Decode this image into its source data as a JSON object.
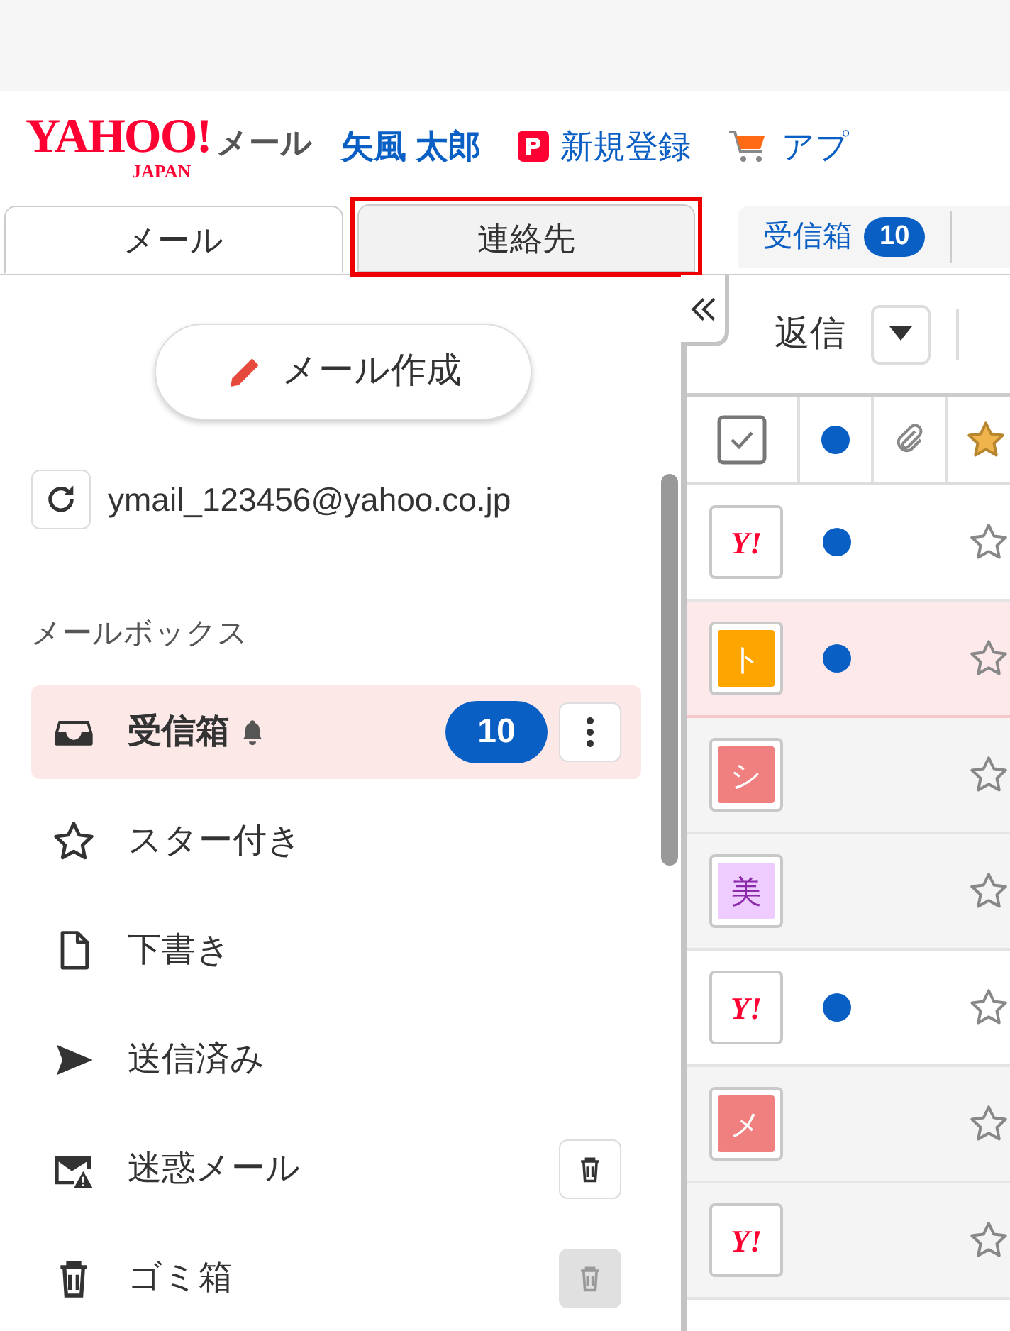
{
  "header": {
    "logo": {
      "main": "YAHOO!",
      "sub": "JAPAN"
    },
    "service": "メール",
    "user_name": "矢風 太郎",
    "links": [
      {
        "kind": "paypay",
        "label": "新規登録"
      },
      {
        "kind": "cart",
        "label": "アプ"
      }
    ]
  },
  "tabs": [
    {
      "label": "メール",
      "selected": true,
      "highlighted": false
    },
    {
      "label": "連絡先",
      "selected": false,
      "highlighted": true
    }
  ],
  "folder_chip": {
    "label": "受信箱",
    "count": "10"
  },
  "sidebar": {
    "compose": "メール作成",
    "account": "ymail_123456@yahoo.co.jp",
    "section": "メールボックス",
    "folders": [
      {
        "kind": "inbox",
        "label": "受信箱",
        "selected": true,
        "bell": true,
        "count": "10",
        "menu_button": true
      },
      {
        "kind": "star",
        "label": "スター付き",
        "selected": false,
        "bell": false
      },
      {
        "kind": "draft",
        "label": "下書き",
        "selected": false,
        "bell": false
      },
      {
        "kind": "sent",
        "label": "送信済み",
        "selected": false,
        "bell": false
      },
      {
        "kind": "spam",
        "label": "迷惑メール",
        "selected": false,
        "bell": false,
        "clear_button": true,
        "clear_disabled": false
      },
      {
        "kind": "trash",
        "label": "ゴミ箱",
        "selected": false,
        "bell": false,
        "clear_button": true,
        "clear_disabled": true
      }
    ]
  },
  "toolbar": {
    "reply": "返信"
  },
  "header_row": {
    "checked": true,
    "starred": true
  },
  "messages": [
    {
      "kind": "yahoo",
      "text": "Y!",
      "unread": true,
      "selected": false,
      "starred": false
    },
    {
      "kind": "letter",
      "text": "ト",
      "color": "#ffa500",
      "unread": true,
      "selected": true,
      "starred": false
    },
    {
      "kind": "letter",
      "text": "シ",
      "color": "#f08080",
      "unread": false,
      "selected": false,
      "starred": false
    },
    {
      "kind": "letter",
      "text": "美",
      "color": "#eeccff",
      "unread": false,
      "selected": false,
      "starred": false
    },
    {
      "kind": "yahoo",
      "text": "Y!",
      "unread": true,
      "selected": false,
      "starred": false
    },
    {
      "kind": "letter",
      "text": "メ",
      "color": "#f08080",
      "unread": false,
      "selected": false,
      "starred": false
    },
    {
      "kind": "yahoo",
      "text": "Y!",
      "unread": false,
      "selected": false,
      "starred": false
    }
  ]
}
